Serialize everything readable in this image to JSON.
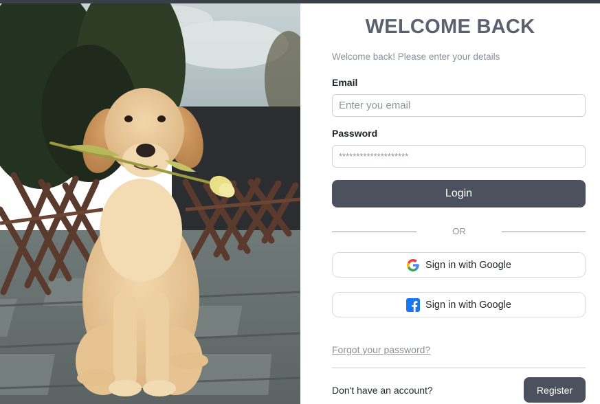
{
  "header": {
    "title": "WELCOME BACK",
    "subtitle": "Welcome back! Please enter your details"
  },
  "form": {
    "email_label": "Email",
    "email_placeholder": "Enter you email",
    "email_value": "",
    "password_label": "Password",
    "password_placeholder": "********************",
    "password_value": "",
    "login_label": "Login"
  },
  "divider": {
    "text": "OR"
  },
  "social": {
    "google_label": "Sign in with Google",
    "facebook_label": "Sign in with Google",
    "google_icon": "google-icon",
    "facebook_icon": "facebook-icon"
  },
  "footer": {
    "forgot_label": "Forgot your password?",
    "no_account_text": "Don't have an account?",
    "register_label": "Register"
  },
  "colors": {
    "primary_button": "#4b525e",
    "title": "#5b616c",
    "muted_text": "#8b9099",
    "facebook_blue": "#1877f2"
  }
}
